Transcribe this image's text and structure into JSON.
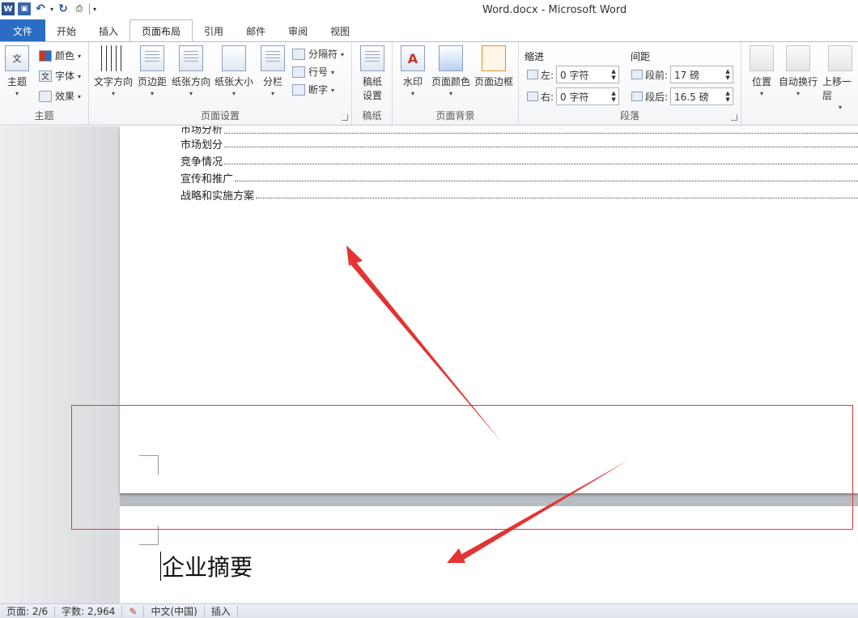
{
  "window": {
    "title": "Word.docx  -  Microsoft Word"
  },
  "tabs": [
    "文件",
    "开始",
    "插入",
    "页面布局",
    "引用",
    "邮件",
    "审阅",
    "视图"
  ],
  "ribbon": {
    "theme": {
      "label": "主题",
      "colors": "颜色",
      "fonts": "字体",
      "effects": "效果",
      "group": "主题"
    },
    "page_setup": {
      "text_direction": "文字方向",
      "margins": "页边距",
      "orientation": "纸张方向",
      "size": "纸张大小",
      "columns": "分栏",
      "breaks": "分隔符",
      "line_numbers": "行号",
      "hyphenation": "断字",
      "group": "页面设置"
    },
    "manuscript": {
      "button_line1": "稿纸",
      "button_line2": "设置",
      "group": "稿纸"
    },
    "page_background": {
      "watermark": "水印",
      "page_color": "页面颜色",
      "page_borders": "页面边框",
      "group": "页面背景"
    },
    "paragraph": {
      "indent_label": "缩进",
      "spacing_label": "间距",
      "left_label": "左:",
      "right_label": "右:",
      "left_value": "0 字符",
      "right_value": "0 字符",
      "before_label": "段前:",
      "after_label": "段后:",
      "before_value": "17 磅",
      "after_value": "16.5 磅",
      "group": "段落"
    },
    "arrange": {
      "position": "位置",
      "wrap_text": "自动换行",
      "bring_forward": "上移一层"
    }
  },
  "document": {
    "toc_items": [
      "市场分析",
      "市场划分",
      "竞争情况",
      "宣传和推广",
      "战略和实施方案"
    ],
    "page2_heading": "企业摘要"
  },
  "status": {
    "page": "页面: 2/6",
    "words": "字数: 2,964",
    "language": "中文(中国)",
    "mode": "插入"
  },
  "colors": {
    "accent": "#2a6cc6",
    "annotation": "#e33333"
  }
}
